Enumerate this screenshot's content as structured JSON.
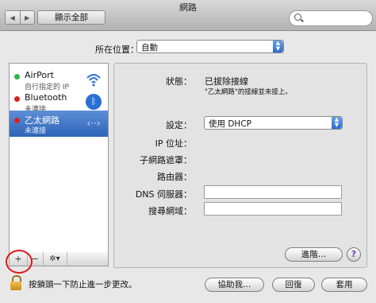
{
  "window": {
    "title": "網路"
  },
  "toolbar": {
    "show_all": "顯示全部",
    "search_placeholder": ""
  },
  "location": {
    "label": "所在位置：",
    "value": "自動"
  },
  "services": [
    {
      "name": "AirPort",
      "status": "自行指定的 IP",
      "dot_color": "#2fb34a",
      "icon": "wifi-icon"
    },
    {
      "name": "Bluetooth",
      "status": "未連接",
      "dot_color": "#d62222",
      "icon": "bluetooth-icon"
    },
    {
      "name": "乙太網路",
      "status": "未連接",
      "dot_color": "#d62222",
      "icon": "ethernet-icon"
    }
  ],
  "sidebar_tools": {
    "add": "+",
    "remove": "−",
    "gear": "✲▾"
  },
  "detail": {
    "status_label": "狀態：",
    "status_value": "已拔除接線",
    "status_desc": "\"乙太網路\"的接線並未接上。",
    "configure_label": "設定：",
    "configure_value": "使用 DHCP",
    "ip_label": "IP 位址：",
    "subnet_label": "子網路遮罩：",
    "router_label": "路由器：",
    "dns_label": "DNS 伺服器：",
    "dns_value": "",
    "search_domains_label": "搜尋網域：",
    "search_domains_value": "",
    "advanced": "進階…",
    "help": "?"
  },
  "footer": {
    "lock_text": "按鎖頭一下防止進一步更改。",
    "assist": "協助我…",
    "revert": "回復",
    "apply": "套用"
  }
}
